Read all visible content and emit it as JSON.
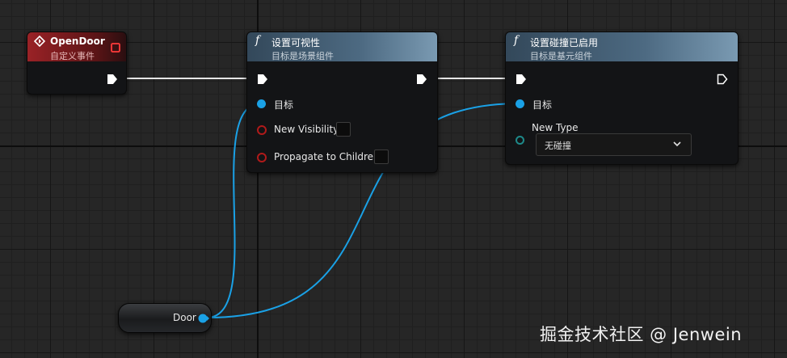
{
  "nodes": {
    "open_door": {
      "title": "OpenDoor",
      "subtitle": "自定义事件"
    },
    "set_visibility": {
      "title": "设置可视性",
      "subtitle": "目标是场景组件",
      "target_label": "目标",
      "new_visibility_label": "New Visibility",
      "propagate_label": "Propagate to Children",
      "new_visibility_checked": false,
      "propagate_checked": false
    },
    "set_collision": {
      "title": "设置碰撞已启用",
      "subtitle": "目标是基元组件",
      "target_label": "目标",
      "new_type_label": "New Type",
      "new_type_value": "无碰撞"
    },
    "door_var": {
      "label": "Door"
    }
  },
  "icons": {
    "event": "diamond-event-icon",
    "function": "function-f-icon",
    "exec": "exec-arrow-icon",
    "data": "data-pin-icon",
    "dropdown": "chevron-down-icon",
    "delegate": "delegate-square-icon"
  },
  "colors": {
    "event_header": "#9a2226",
    "function_header": "#4d6a82",
    "object_pin": "#1aa1e6",
    "bool_pin": "#b01a1a",
    "enum_pin": "#1e8a8a",
    "exec_wire": "#e6e6e6",
    "object_wire": "#1aa1e6"
  },
  "watermark": "掘金技术社区 @ Jenwein"
}
